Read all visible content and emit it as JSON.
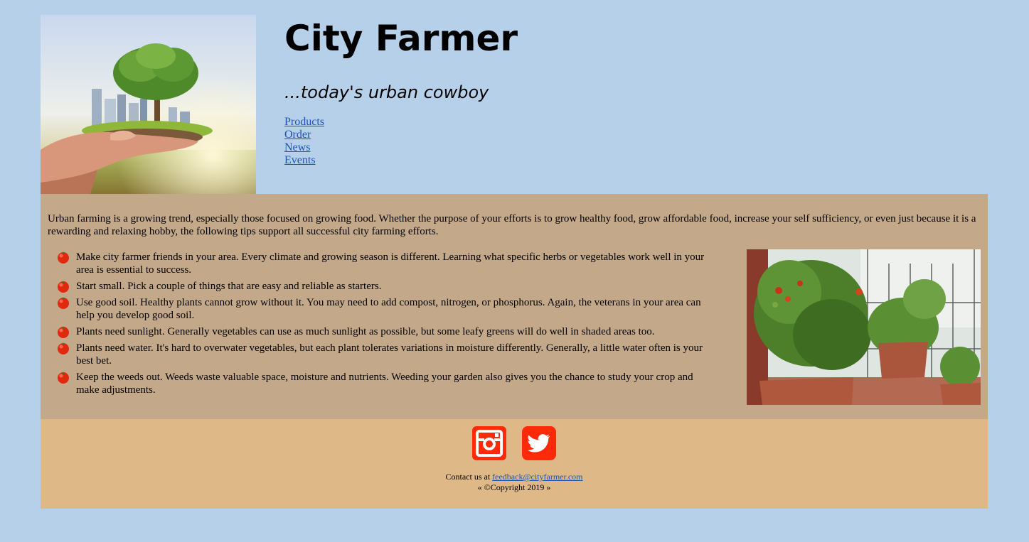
{
  "header": {
    "title": "City Farmer",
    "tagline": "...today's urban cowboy",
    "nav": [
      "Products",
      "Order",
      "News",
      "Events"
    ]
  },
  "main": {
    "intro": "Urban farming is a growing trend, especially those focused on growing food. Whether the purpose of your efforts is to grow healthy food, grow affordable food, increase your self sufficiency, or even just because it is a rewarding and relaxing hobby, the following tips support all successful city farming efforts.",
    "tips": [
      "Make city farmer friends in your area. Every climate and growing season is different. Learning what specific herbs or vegetables work well in your area is essential to success.",
      "Start small. Pick a couple of things that are easy and reliable as starters.",
      "Use good soil. Healthy plants cannot grow without it. You may need to add compost, nitrogen, or phosphorus. Again, the veterans in your area can help you develop good soil.",
      "Plants need sunlight. Generally vegetables can use as much sunlight as possible, but some leafy greens will do well in shaded areas too.",
      "Plants need water. It's hard to overwater vegetables, but each plant tolerates variations in moisture differently. Generally, a little water often is your best bet.",
      "Keep the weeds out. Weeds waste valuable space, moisture and nutrients. Weeding your garden also gives you the chance to study your crop and make adjustments."
    ],
    "bullet_icon": "tomato-icon"
  },
  "footer": {
    "social": [
      "instagram-icon",
      "twitter-icon"
    ],
    "contact_prefix": "Contact us at",
    "email": "feedback@cityfarmer.com",
    "copyright": "« ©Copyright 2019 »"
  },
  "colors": {
    "page_bg": "#b6d0ea",
    "main_bg": "#c4a88a",
    "footer_bg": "#deb887",
    "social_red": "#ff2a0a",
    "link": "#1a55b5"
  }
}
